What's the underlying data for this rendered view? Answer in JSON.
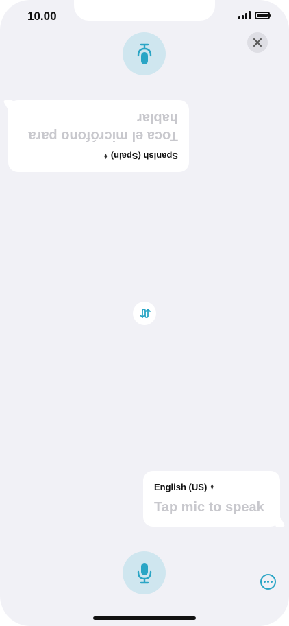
{
  "status_bar": {
    "time": "10.00"
  },
  "top_panel": {
    "language": "Spanish (Spain)",
    "prompt": "Toca el micrófono para hablar"
  },
  "bottom_panel": {
    "language": "English (US)",
    "prompt": "Tap mic to speak"
  },
  "colors": {
    "accent": "#2aa5c5",
    "mic_bg": "#cfe6ef",
    "background": "#f1f1f6",
    "placeholder": "#c8c8cd"
  },
  "icons": {
    "close": "close-icon",
    "mic": "microphone-icon",
    "swap": "swap-icon",
    "more": "more-icon"
  }
}
